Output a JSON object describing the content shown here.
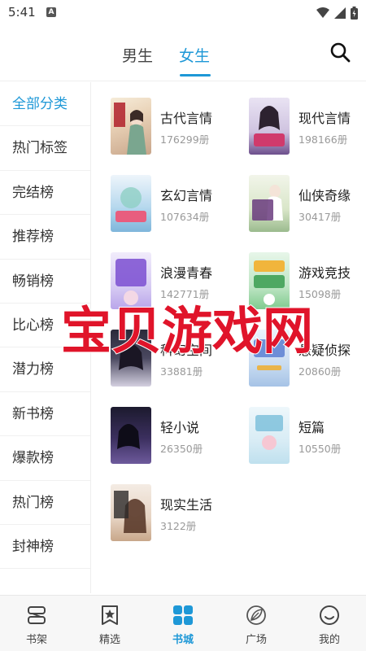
{
  "status_bar": {
    "time": "5:41",
    "app_badge": "A"
  },
  "header": {
    "tabs": [
      {
        "label": "男生",
        "active": false
      },
      {
        "label": "女生",
        "active": true
      }
    ],
    "search_icon": "search-icon"
  },
  "sidebar": {
    "items": [
      {
        "label": "全部分类",
        "active": true
      },
      {
        "label": "热门标签",
        "active": false
      },
      {
        "label": "完结榜",
        "active": false
      },
      {
        "label": "推荐榜",
        "active": false
      },
      {
        "label": "畅销榜",
        "active": false
      },
      {
        "label": "比心榜",
        "active": false
      },
      {
        "label": "潜力榜",
        "active": false
      },
      {
        "label": "新书榜",
        "active": false
      },
      {
        "label": "爆款榜",
        "active": false
      },
      {
        "label": "热门榜",
        "active": false
      },
      {
        "label": "封神榜",
        "active": false
      }
    ]
  },
  "categories": [
    {
      "name": "古代言情",
      "count": "176299册"
    },
    {
      "name": "现代言情",
      "count": "198166册"
    },
    {
      "name": "玄幻言情",
      "count": "107634册"
    },
    {
      "name": "仙侠奇缘",
      "count": "30417册"
    },
    {
      "name": "浪漫青春",
      "count": "142771册"
    },
    {
      "name": "游戏竞技",
      "count": "15098册"
    },
    {
      "name": "科幻空间",
      "count": "33881册"
    },
    {
      "name": "悬疑侦探",
      "count": "20860册"
    },
    {
      "name": "轻小说",
      "count": "26350册"
    },
    {
      "name": "短篇",
      "count": "10550册"
    },
    {
      "name": "现实生活",
      "count": "3122册"
    }
  ],
  "watermark": {
    "text": "宝贝游戏网"
  },
  "bottom_nav": {
    "items": [
      {
        "label": "书架",
        "icon": "bookshelf-icon",
        "active": false
      },
      {
        "label": "精选",
        "icon": "featured-star-icon",
        "active": false
      },
      {
        "label": "书城",
        "icon": "bookstore-grid-icon",
        "active": true
      },
      {
        "label": "广场",
        "icon": "plaza-leaf-icon",
        "active": false
      },
      {
        "label": "我的",
        "icon": "profile-smile-icon",
        "active": false
      }
    ]
  },
  "colors": {
    "accent": "#1e98d7",
    "watermark": "#e0142a",
    "muted": "#999999"
  }
}
